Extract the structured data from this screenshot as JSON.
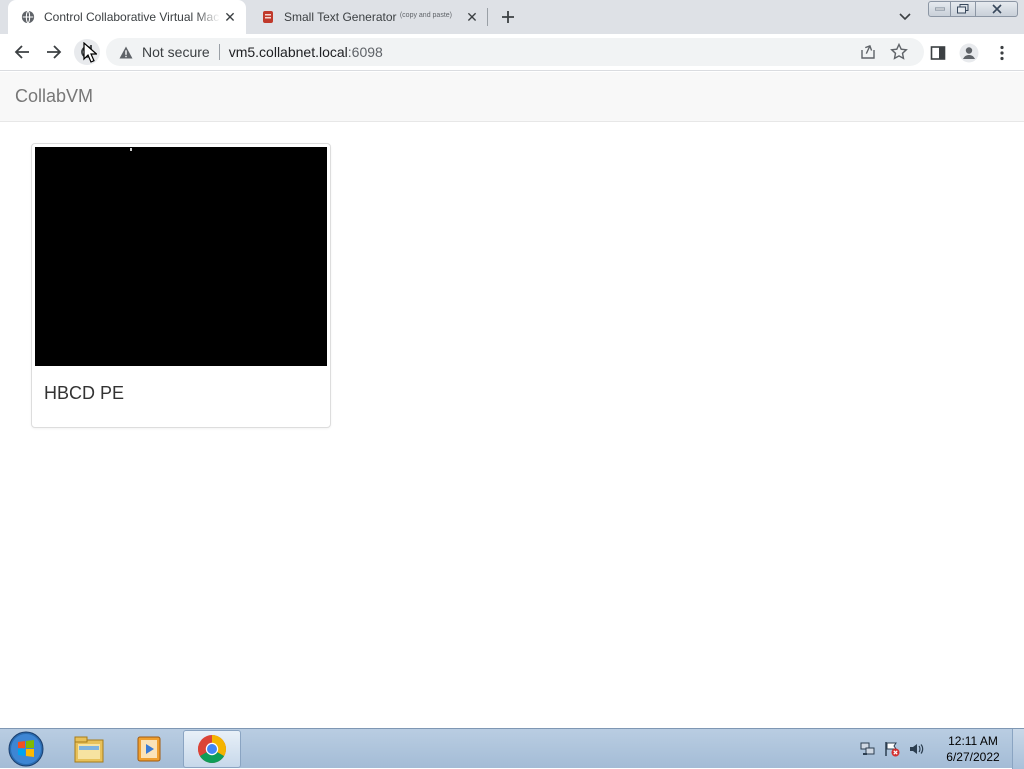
{
  "browser": {
    "tabs": [
      {
        "title": "Control Collaborative Virtual Machines",
        "favicon": "globe-icon",
        "active": true
      },
      {
        "title": "Small Text Generator",
        "title_sup": "(copy and paste)",
        "favicon": "generator-favicon",
        "active": false
      }
    ],
    "address": {
      "security_label": "Not secure",
      "host": "vm5.collabnet.local",
      "port": ":6098"
    },
    "toolbar_icons": [
      "back-arrow-icon",
      "forward-arrow-icon",
      "reload-icon",
      "share-icon",
      "star-icon",
      "side-panel-icon",
      "profile-icon",
      "menu-dots-icon"
    ]
  },
  "page": {
    "brand": "CollabVM",
    "vms": [
      {
        "name": "HBCD PE",
        "thumbnail_color": "#000000"
      }
    ]
  },
  "taskbar": {
    "pinned": [
      "windows-start-icon",
      "file-explorer-icon",
      "media-player-icon",
      "chrome-icon"
    ],
    "tray_icons": [
      "network-icon",
      "action-center-flag-icon",
      "volume-icon"
    ],
    "clock": {
      "time": "12:11 AM",
      "date": "6/27/2022"
    }
  },
  "colors": {
    "tabstrip": "#dee1e6",
    "navbar": "#f8f8f8",
    "brand": "#777777",
    "taskbar": "#a4bcd6"
  }
}
